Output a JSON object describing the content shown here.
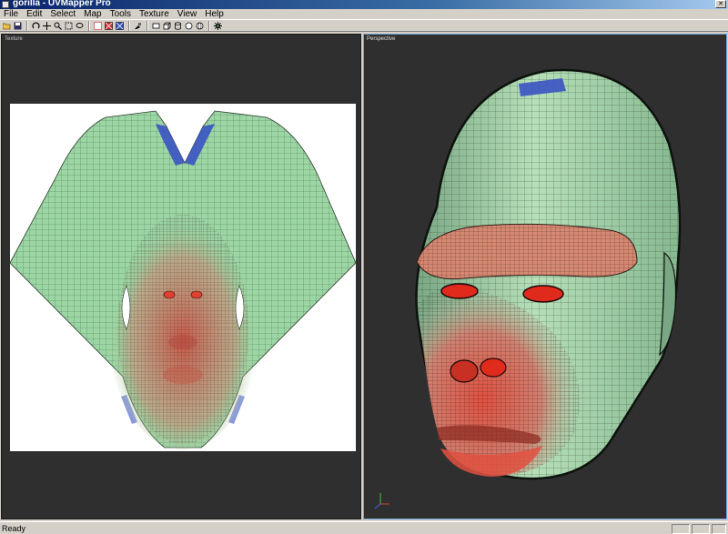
{
  "window": {
    "title": "gorilla - UVMapper Pro"
  },
  "menu": [
    "File",
    "Edit",
    "Select",
    "Map",
    "Tools",
    "Texture",
    "View",
    "Help"
  ],
  "toolbar": {
    "tools": [
      "open-icon",
      "save-icon",
      "rotate-icon",
      "pan-icon",
      "zoom-icon",
      "select-rect-icon",
      "select-lasso-icon",
      "grid-icon",
      "show-red-icon",
      "show-blue-icon",
      "paint-icon",
      "view-plane-icon",
      "view-cube-icon",
      "view-cylinder-icon",
      "view-sphere-icon",
      "view-globe-icon",
      "settings-gear-icon"
    ]
  },
  "viewports": {
    "left": {
      "label": "Texture"
    },
    "right": {
      "label": "Perspective"
    }
  },
  "colors": {
    "mesh_green": "#9cd6a4",
    "mesh_red": "#d95a4c",
    "mesh_blue": "#3b53c4",
    "viewport_bg": "#2f2f2f",
    "active_border": "#6fa3d8"
  },
  "status": {
    "text": "Ready"
  }
}
